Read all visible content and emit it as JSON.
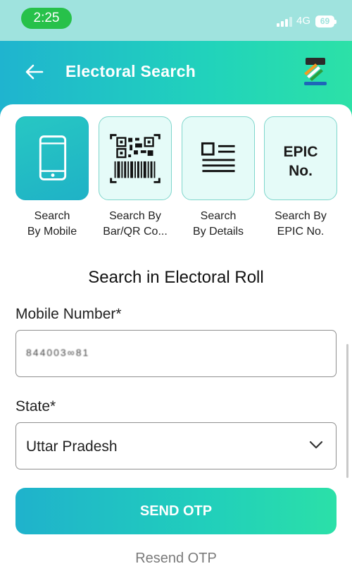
{
  "status_bar": {
    "time": "2:25",
    "network": "4G",
    "battery": "69"
  },
  "header": {
    "title": "Electoral Search",
    "back_icon": "arrow-left-icon"
  },
  "search_options": [
    {
      "label_line1": "Search",
      "label_line2": "By Mobile",
      "icon": "mobile-phone-icon",
      "active": true
    },
    {
      "label_line1": "Search By",
      "label_line2": "Bar/QR Co...",
      "icon": "qr-barcode-icon",
      "active": false
    },
    {
      "label_line1": "Search",
      "label_line2": "By Details",
      "icon": "details-list-icon",
      "active": false
    },
    {
      "label_line1": "Search By",
      "label_line2": "EPIC No.",
      "icon_line1": "EPIC",
      "icon_line2": "No.",
      "active": false
    }
  ],
  "form": {
    "section_title": "Search in Electoral Roll",
    "mobile_label": "Mobile Number*",
    "mobile_value": "844003∞81",
    "state_label": "State*",
    "state_value": "Uttar Pradesh"
  },
  "actions": {
    "send_otp": "SEND OTP",
    "resend_otp": "Resend OTP"
  },
  "colors": {
    "accent_start": "#1fb2cc",
    "accent_end": "#2be0a8",
    "status_bar": "#9fe3de",
    "time_pill": "#27c14a"
  }
}
